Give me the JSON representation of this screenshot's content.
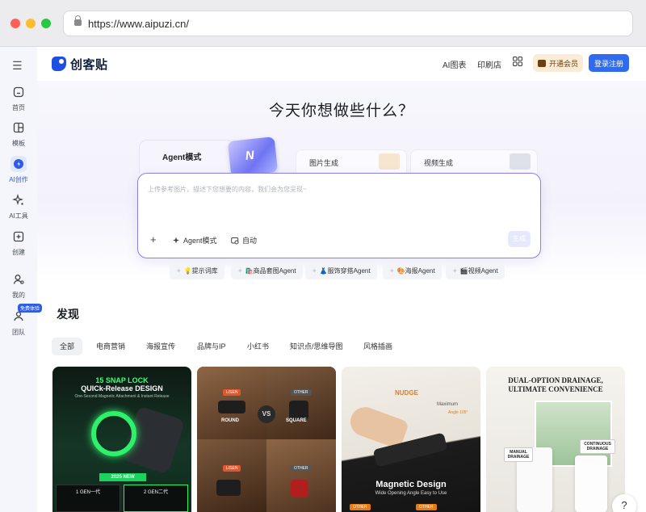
{
  "browser": {
    "url": "https://www.aipuzi.cn/"
  },
  "sidebar": {
    "items": [
      {
        "label": "首页",
        "icon": "home-icon"
      },
      {
        "label": "模板",
        "icon": "template-icon"
      },
      {
        "label": "AI创作",
        "icon": "ai-create-icon",
        "active": true
      },
      {
        "label": "AI工具",
        "icon": "sparkle-icon"
      },
      {
        "label": "创建",
        "icon": "plus-square-icon"
      },
      {
        "label": "我的",
        "icon": "user-icon"
      },
      {
        "label": "团队",
        "icon": "team-icon",
        "badge": "免费体验"
      }
    ]
  },
  "header": {
    "logo_text": "创客贴",
    "links": [
      "AI图表",
      "印刷店"
    ],
    "vip_label": "开通会员",
    "login_label": "登录注册"
  },
  "hero": {
    "title": "今天你想做些什么？",
    "tabs": {
      "agent": "Agent模式",
      "image": "图片生成",
      "video": "视频生成"
    },
    "placeholder": "上传参考图片，描述下您想要的内容，我们会为您呈现~",
    "mode_label": "Agent模式",
    "auto_label": "自动",
    "send_label": "生成"
  },
  "chips": [
    "💡提示词库",
    "🛍️商品套图Agent",
    "👗服饰穿搭Agent",
    "🎨海报Agent",
    "🎬视频Agent"
  ],
  "discover": {
    "title": "发现",
    "categories": [
      "全部",
      "电商营销",
      "海报宣传",
      "品牌与IP",
      "小红书",
      "知识点/思维导图",
      "风格插画"
    ]
  },
  "cards": {
    "c1": {
      "line1": "15 SNAP LOCK",
      "line2": "QUICk-Release DESIGN",
      "line3": "One-Second Magnetic Attachment & Instant Release",
      "badge": "2025 NEW",
      "left": "1 GEN一代",
      "right": "2 GEN二代"
    },
    "c2": {
      "tag1": "LISEN",
      "tag2": "OTHER",
      "cap1": "ROUND",
      "cap2": "SQUARE",
      "tag3": "LISEN",
      "tag4": "OTHER",
      "vs": "VS"
    },
    "c3": {
      "nudge": "NUDGE",
      "max": "Maximum",
      "angle": "Angle 105°",
      "title": "Magnetic Design",
      "sub": "Wide Opening Angle Easy to Use",
      "tag1": "OTHER",
      "tag2": "OTHER"
    },
    "c4": {
      "heading1": "DUAL-OPTION DRAINAGE,",
      "heading2": "ULTIMATE CONVENIENCE",
      "manual": "MANUAL DRAINAGE",
      "continuous": "CONTINUOUS DRAINAGE"
    }
  },
  "help_label": "?"
}
